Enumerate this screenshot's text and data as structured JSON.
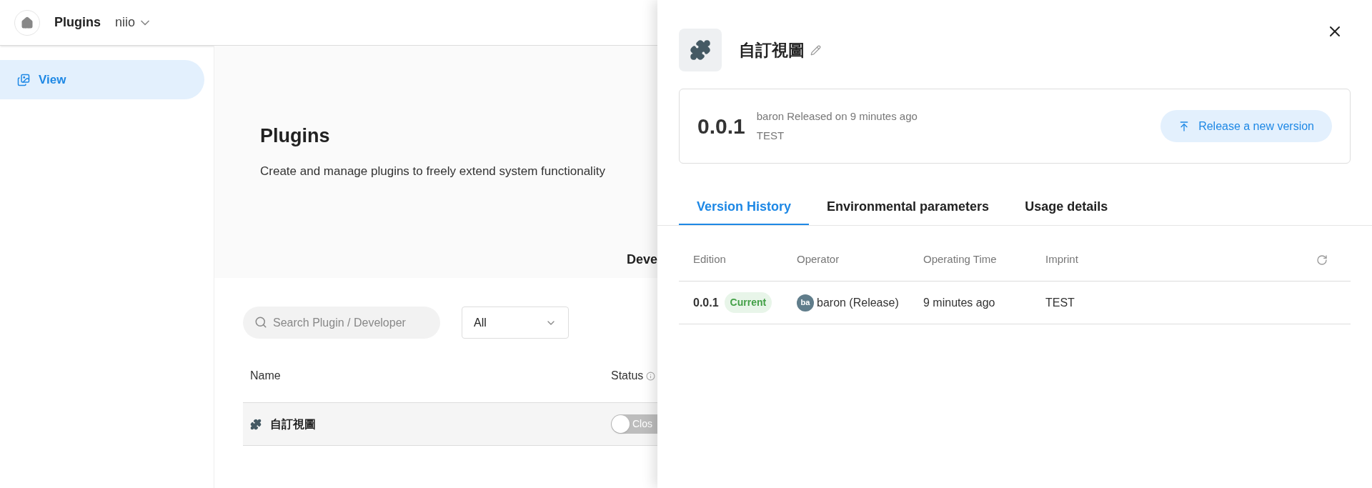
{
  "header": {
    "title": "Plugins",
    "workspace": "niio"
  },
  "sidebar": {
    "items": [
      {
        "label": "View",
        "selected": true
      }
    ]
  },
  "hero": {
    "title": "Plugins",
    "description": "Create and manage plugins to freely extend system functionality",
    "tab_partial": "Deve"
  },
  "search": {
    "placeholder": "Search Plugin / Developer"
  },
  "filter": {
    "value": "All"
  },
  "table": {
    "columns": [
      "Name",
      "Status"
    ],
    "rows": [
      {
        "name": "自訂視圖",
        "status": "Clos",
        "on": false
      }
    ]
  },
  "drawer": {
    "title": "自訂視圖",
    "release": {
      "version": "0.0.1",
      "info": "baron Released on 9 minutes ago",
      "note": "TEST",
      "button": "Release a new version"
    },
    "tabs": [
      {
        "label": "Version History",
        "selected": true
      },
      {
        "label": "Environmental parameters",
        "selected": false
      },
      {
        "label": "Usage details",
        "selected": false
      }
    ],
    "history": {
      "columns": [
        "Edition",
        "Operator",
        "Operating Time",
        "Imprint"
      ],
      "rows": [
        {
          "edition": "0.0.1",
          "badge": "Current",
          "avatar": "ba",
          "operator": "baron (Release)",
          "time": "9 minutes ago",
          "imprint": "TEST"
        }
      ]
    }
  }
}
